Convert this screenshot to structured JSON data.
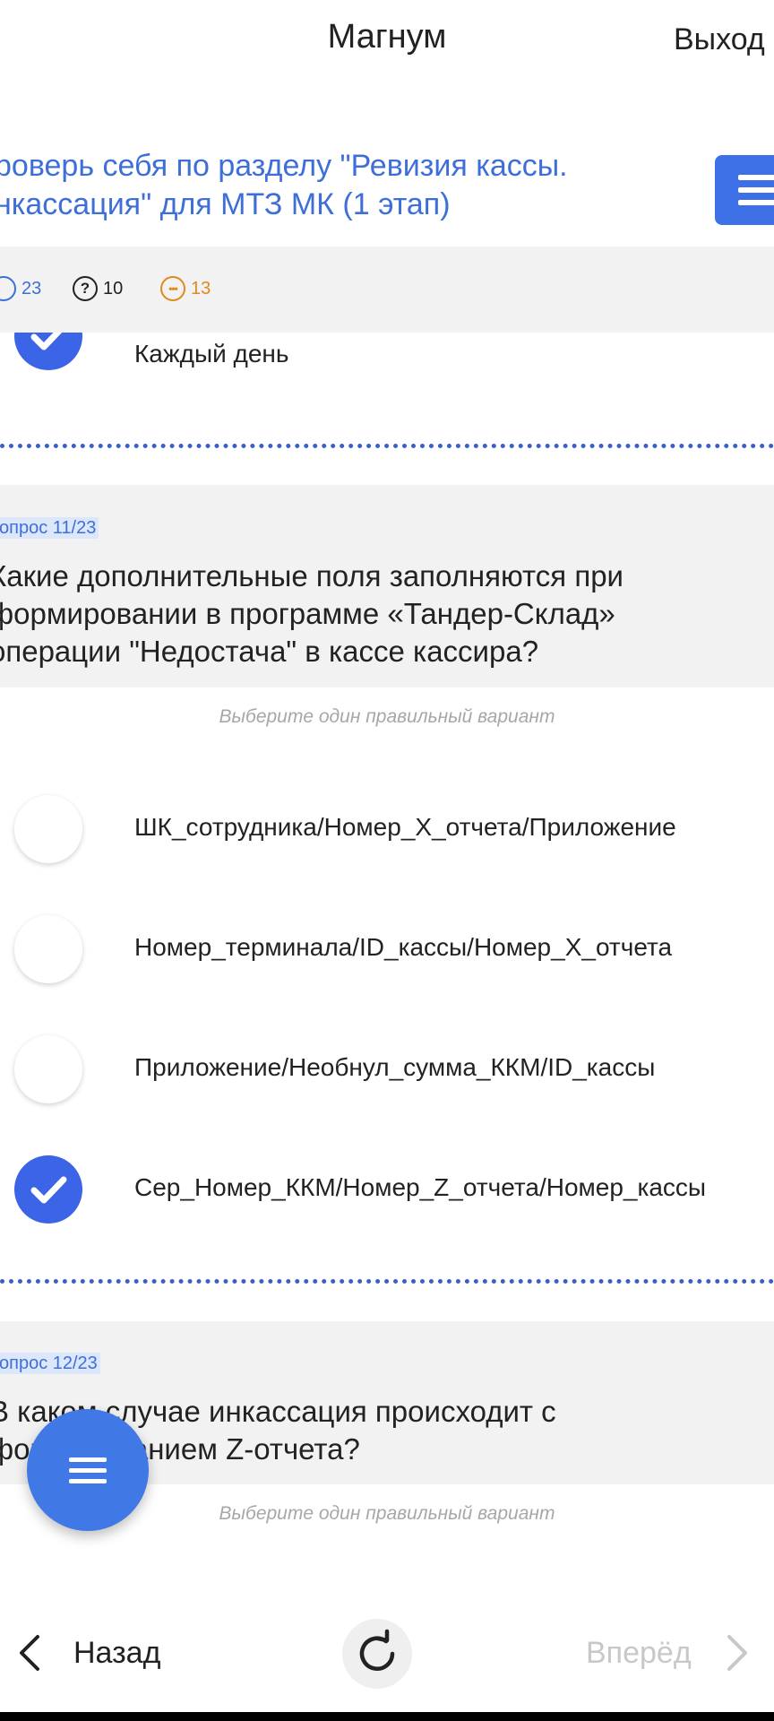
{
  "header": {
    "title": "Магнум",
    "exit_label": "Выход"
  },
  "test": {
    "title_line1": "роверь себя по разделу \"Ревизия кассы.",
    "title_line2": "нкассация\" для МТЗ МК (1 этап)"
  },
  "stats": {
    "total": "23",
    "unanswered": "10",
    "pending": "13"
  },
  "prev_answer": {
    "label": "Каждый день",
    "selected": true
  },
  "question11": {
    "number": "опрос 11/23",
    "line1": "Какие дополнительные поля заполняются при",
    "line2": "формировании в программе «Тандер-Склад»",
    "line3": "операции \"Недостача\" в кассе кассира?",
    "hint": "Выберите один правильный вариант",
    "options": [
      {
        "label": "ШК_сотрудника/Номер_Х_отчета/Приложение",
        "selected": false
      },
      {
        "label": "Номер_терминала/ID_кассы/Номер_Х_отчета",
        "selected": false
      },
      {
        "label": "Приложение/Необнул_сумма_ККМ/ID_кассы",
        "selected": false
      },
      {
        "label": "Сер_Номер_ККМ/Номер_Z_отчета/Номер_кассы",
        "selected": true
      }
    ]
  },
  "question12": {
    "number": "опрос 12/23",
    "line1": "В каком случае инкассация происходит с",
    "line2": "формированием Z-отчета?",
    "hint": "Выберите один правильный вариант"
  },
  "footer": {
    "back_label": "Назад",
    "next_label": "Вперёд"
  },
  "colors": {
    "accent": "#3c64e6",
    "link_text": "#3e6fd8",
    "band": "#f2f2f2",
    "pending": "#e08a1e"
  }
}
